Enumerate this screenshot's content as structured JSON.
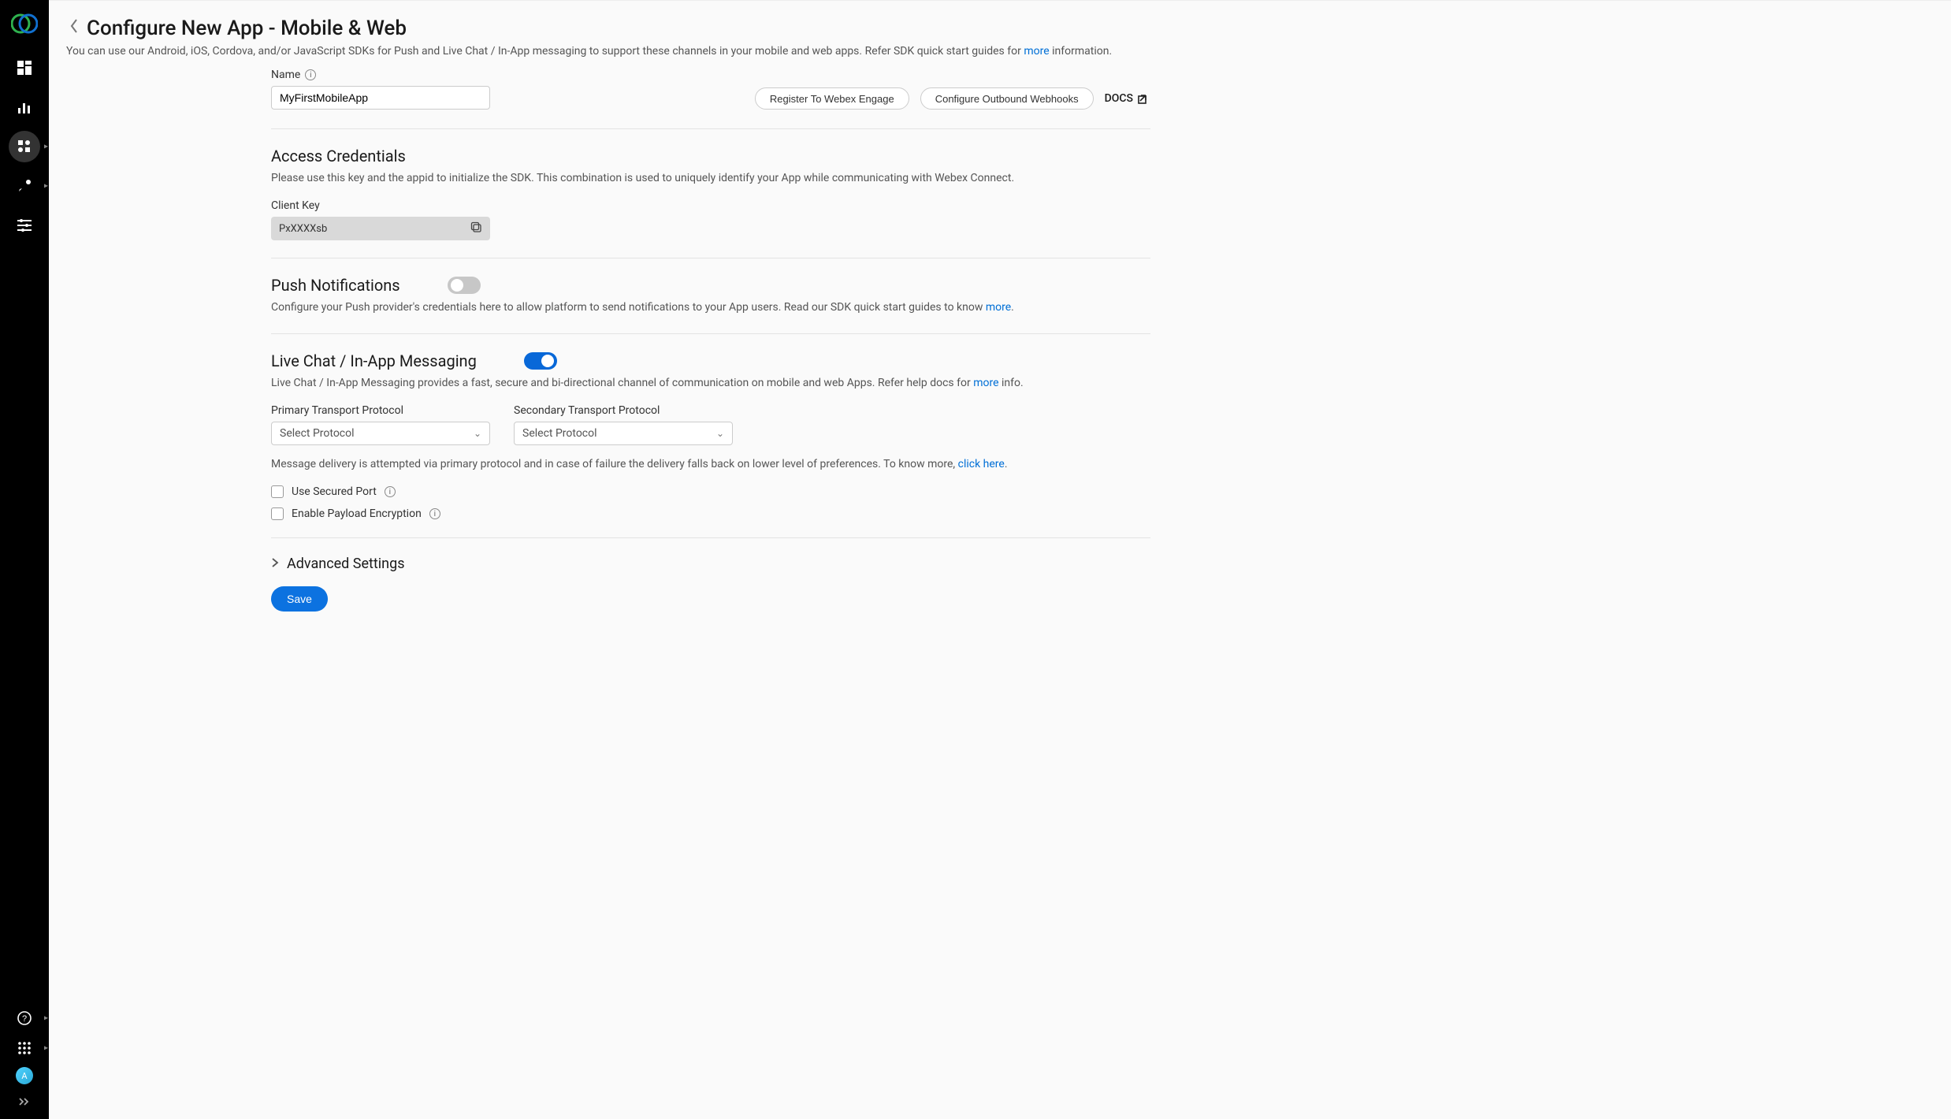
{
  "sidebar": {
    "avatar_initial": "A"
  },
  "header": {
    "title": "Configure New App - Mobile & Web",
    "subtitle_pre": "You can use our Android, iOS, Cordova, and/or JavaScript SDKs for Push and Live Chat / In-App messaging to support these channels in your mobile and web apps. Refer SDK quick start guides for ",
    "subtitle_link": "more",
    "subtitle_post": " information."
  },
  "form": {
    "name_label": "Name",
    "name_value": "MyFirstMobileApp",
    "register_btn": "Register To Webex Engage",
    "webhooks_btn": "Configure Outbound Webhooks",
    "docs_label": "DOCS"
  },
  "access": {
    "title": "Access Credentials",
    "desc": "Please use this key and the appid to initialize the SDK. This combination is used to uniquely identify your App while communicating with Webex Connect.",
    "client_key_label": "Client Key",
    "client_key_value": "PxXXXXsb"
  },
  "push": {
    "title": "Push Notifications",
    "desc_pre": "Configure your Push provider's credentials here to allow platform to send notifications to your App users. Read our SDK quick start guides to know ",
    "desc_link": "more",
    "desc_post": "."
  },
  "livechat": {
    "title": "Live Chat / In-App Messaging",
    "desc_pre": "Live Chat / In-App Messaging provides a fast, secure and bi-directional channel of communication on mobile and web Apps. Refer help docs for ",
    "desc_link": "more",
    "desc_post": " info.",
    "primary_label": "Primary Transport Protocol",
    "secondary_label": "Secondary Transport Protocol",
    "select_placeholder": "Select Protocol",
    "delivery_note_pre": "Message delivery is attempted via primary protocol and in case of failure the delivery falls back on lower level of preferences. To know more, ",
    "delivery_note_link": "click here",
    "delivery_note_post": ".",
    "secured_port_label": "Use Secured Port",
    "encryption_label": "Enable Payload Encryption"
  },
  "advanced": {
    "title": "Advanced Settings"
  },
  "footer": {
    "save_label": "Save"
  }
}
